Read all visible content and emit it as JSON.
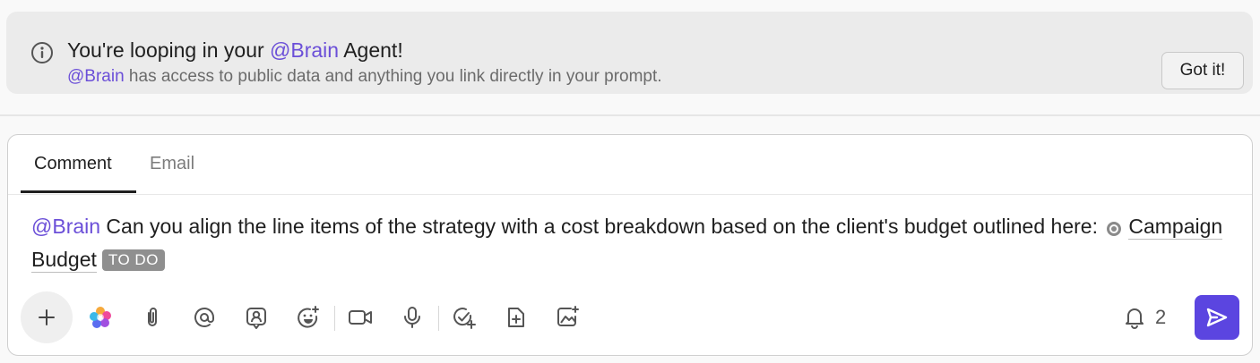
{
  "banner": {
    "title_prefix": "You're looping in your ",
    "title_mention": "@Brain",
    "title_suffix": " Agent!",
    "subtitle_mention": "@Brain",
    "subtitle_text": " has access to public data and anything you link directly in your prompt.",
    "dismiss_label": "Got it!",
    "icon": "info-icon"
  },
  "composer": {
    "tabs": [
      {
        "label": "Comment",
        "active": true
      },
      {
        "label": "Email",
        "active": false
      }
    ],
    "message": {
      "mention": "@Brain",
      "text": " Can you align the line items of the strategy with a cost breakdown based on the client's budget outlined here: ",
      "task": {
        "name": "Campaign Budget",
        "status": "TO DO"
      }
    },
    "toolbar": {
      "tools": [
        "plus-icon",
        "ai-sparkle-icon",
        "attachment-icon",
        "mention-icon",
        "assign-person-icon",
        "emoji-icon",
        "video-icon",
        "microphone-icon",
        "task-check-icon",
        "add-doc-icon",
        "image-edit-icon"
      ],
      "notification_count": "2",
      "send_icon": "send-icon"
    },
    "colors": {
      "accent": "#5b45e0",
      "mention": "#6b4fd8"
    }
  }
}
